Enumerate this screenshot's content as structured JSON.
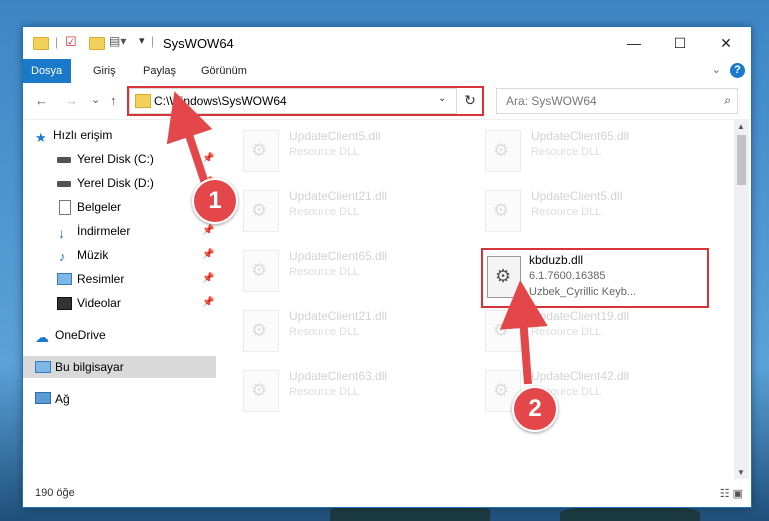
{
  "window": {
    "title": "SysWOW64"
  },
  "ribbon": {
    "tabs": [
      "Dosya",
      "Giriş",
      "Paylaş",
      "Görünüm"
    ],
    "help_icon": "?"
  },
  "nav": {
    "back": "←",
    "forward": "→",
    "recent": "⌄",
    "up": "↑"
  },
  "address": {
    "path": "C:\\Windows\\SysWOW64",
    "refresh": "↻"
  },
  "search": {
    "placeholder": "Ara: SysWOW64"
  },
  "sidebar": {
    "items": [
      {
        "label": "Hızlı erişim",
        "icon": "star-icon"
      },
      {
        "label": "Yerel Disk (C:)",
        "icon": "drive-icon"
      },
      {
        "label": "Yerel Disk (D:)",
        "icon": "drive-icon"
      },
      {
        "label": "Belgeler",
        "icon": "document-icon"
      },
      {
        "label": "İndirmeler",
        "icon": "download-icon"
      },
      {
        "label": "Müzik",
        "icon": "music-icon"
      },
      {
        "label": "Resimler",
        "icon": "picture-icon"
      },
      {
        "label": "Videolar",
        "icon": "video-icon"
      },
      {
        "label": "OneDrive",
        "icon": "cloud-icon"
      },
      {
        "label": "Bu bilgisayar",
        "icon": "computer-icon"
      },
      {
        "label": "Ağ",
        "icon": "network-icon"
      }
    ]
  },
  "files": [
    {
      "name": "UpdateClient5.dll",
      "type": "Resource DLL"
    },
    {
      "name": "UpdateClient65.dll",
      "type": "Resource DLL"
    },
    {
      "name": "UpdateClient21.dll",
      "type": "Resource DLL"
    },
    {
      "name": "UpdateClient5.dll",
      "type": "Resource DLL"
    },
    {
      "name": "UpdateClient65.dll",
      "type": "Resource DLL"
    },
    {
      "name": "UpdateClient21.dll",
      "type": "Resource DLL"
    },
    {
      "name": "UpdateClient19.dll",
      "type": "Resource DLL"
    },
    {
      "name": "UpdateClient63.dll",
      "type": "Resource DLL"
    },
    {
      "name": "UpdateClient42.dll",
      "type": "Resource DLL"
    }
  ],
  "highlighted_file": {
    "name": "kbduzb.dll",
    "version": "6.1.7600.16385",
    "description": "Uzbek_Cyrillic Keyb..."
  },
  "callouts": [
    "1",
    "2"
  ],
  "status": {
    "count": "190 öğe"
  },
  "colors": {
    "accent": "#1979ca",
    "highlight": "#d9333a",
    "callout": "#e3474a"
  }
}
